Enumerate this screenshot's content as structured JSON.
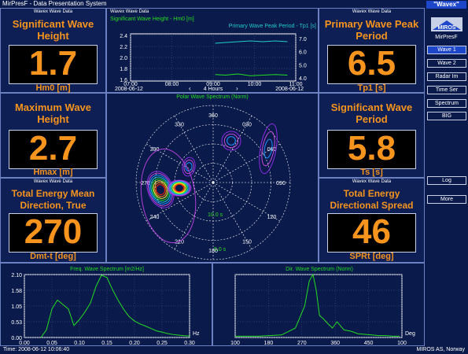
{
  "app": {
    "title": "MirPresF - Data Presentation System",
    "name": "\"Wavex\"",
    "brand": "MirPresF",
    "logo": "MIROS"
  },
  "tag": "Wavex Wave Data",
  "widgets": [
    {
      "title": "Significant Wave Height",
      "value": "1.7",
      "unit": "Hm0 [m]"
    },
    {
      "title": "Maximum Wave Height",
      "value": "2.7",
      "unit": "Hmax [m]"
    },
    {
      "title": "Total Energy Mean Direction, True",
      "value": "270",
      "unit": "Dmt-t [deg]"
    },
    {
      "title": "Primary Wave Peak Period",
      "value": "6.5",
      "unit": "Tp1 [s]"
    },
    {
      "title": "Significant Wave Period",
      "value": "5.8",
      "unit": "Ts [s]"
    },
    {
      "title": "Total Energy Directional Spread",
      "value": "46",
      "unit": "SPRt [deg]"
    }
  ],
  "sidebar": {
    "buttons": [
      "Wave 1",
      "Wave 2",
      "Radar Im",
      "Time Ser",
      "Spectrum",
      "BIG"
    ],
    "lower_buttons": [
      "Log",
      "More"
    ]
  },
  "colors": {
    "accent": "#f7941d",
    "bg": "#0a1a4a",
    "panel": "#0d1f55",
    "series1": "#22dd22",
    "series2": "#22cccc",
    "active": "#1e46c8"
  },
  "status": {
    "time": "Time: 2008-06-12 10:06:40",
    "company": "MIROS AS, Norway"
  },
  "timeseries": {
    "label1": "Significant Wave Height - Hm0 [m]",
    "label2": "Primary Wave Peak Period - Tp1 [s]",
    "nav_label": "4 Hours",
    "date_left": "2008-06-12",
    "date_right": "2008-06-12"
  },
  "polar": {
    "title": "Polar Wave Spectrum (Norm)",
    "period_labels": [
      "10.0 s",
      "5.0 s"
    ]
  },
  "chart_data": [
    {
      "type": "line",
      "title": "Significant Wave Height - Hm0 [m] / Primary Wave Peak Period - Tp1 [s]",
      "x": [
        "07:00",
        "08:00",
        "09:00",
        "10:00",
        "11:00"
      ],
      "left_axis": {
        "ticks": [
          "2.4",
          "2.2",
          "2.0",
          "1.8",
          "1.6"
        ],
        "ylim": [
          1.6,
          2.4
        ]
      },
      "right_axis": {
        "ticks": [
          "7.0",
          "6.0",
          "5.0",
          "4.0"
        ],
        "ylim": [
          4.0,
          7.0
        ]
      },
      "series": [
        {
          "name": "Hm0 [m]",
          "color": "#22dd22",
          "x": [
            9.05,
            9.3,
            9.6,
            9.9,
            10.2,
            10.5,
            10.8
          ],
          "values": [
            1.71,
            1.7,
            1.72,
            1.69,
            1.7,
            1.71,
            1.7
          ]
        },
        {
          "name": "Tp1 [s]",
          "color": "#22cccc",
          "x": [
            9.05,
            9.3,
            9.6,
            9.9,
            10.2,
            10.5,
            10.8
          ],
          "values": [
            6.4,
            6.45,
            6.5,
            6.55,
            6.5,
            6.55,
            6.5
          ]
        }
      ]
    },
    {
      "type": "line",
      "title": "Freq. Wave Spectrum [m2/Hz]",
      "xlabel": "Hz",
      "xlim": [
        0,
        0.3
      ],
      "ylim": [
        0,
        2.1
      ],
      "xticks": [
        "0.00",
        "0.05",
        "0.10",
        "0.15",
        "0.20",
        "0.25",
        "0.30"
      ],
      "yticks": [
        "2.10",
        "1.58",
        "1.05",
        "0.53",
        "0.00"
      ],
      "series": [
        {
          "color": "#22dd22",
          "x": [
            0.03,
            0.04,
            0.05,
            0.06,
            0.07,
            0.08,
            0.09,
            0.1,
            0.11,
            0.12,
            0.13,
            0.14,
            0.15,
            0.16,
            0.17,
            0.18,
            0.19,
            0.2,
            0.21,
            0.22,
            0.23,
            0.24,
            0.25,
            0.26,
            0.27,
            0.28,
            0.29,
            0.3
          ],
          "values": [
            0.0,
            0.25,
            0.95,
            1.25,
            1.1,
            0.95,
            0.4,
            0.6,
            0.85,
            1.15,
            1.7,
            2.08,
            2.0,
            1.6,
            1.25,
            0.95,
            0.7,
            0.55,
            0.45,
            0.38,
            0.3,
            0.22,
            0.18,
            0.13,
            0.1,
            0.08,
            0.06,
            0.05
          ]
        }
      ]
    },
    {
      "type": "line",
      "title": "Dir. Wave Spectrum (Norm)",
      "xlabel": "Deg",
      "xlim": [
        100,
        460
      ],
      "ylim": [
        0,
        1
      ],
      "xticks": [
        "180",
        "270",
        "360",
        "450",
        "100",
        "100"
      ],
      "series": [
        {
          "color": "#22dd22",
          "x": [
            100,
            150,
            200,
            230,
            250,
            260,
            268,
            275,
            282,
            290,
            300,
            310,
            320,
            335,
            350,
            365,
            380,
            395,
            410,
            425,
            440,
            455
          ],
          "values": [
            0.02,
            0.02,
            0.04,
            0.15,
            0.5,
            0.9,
            1.0,
            0.75,
            0.35,
            0.3,
            0.22,
            0.15,
            0.25,
            0.12,
            0.1,
            0.06,
            0.05,
            0.04,
            0.03,
            0.03,
            0.02,
            0.02
          ]
        }
      ]
    }
  ]
}
